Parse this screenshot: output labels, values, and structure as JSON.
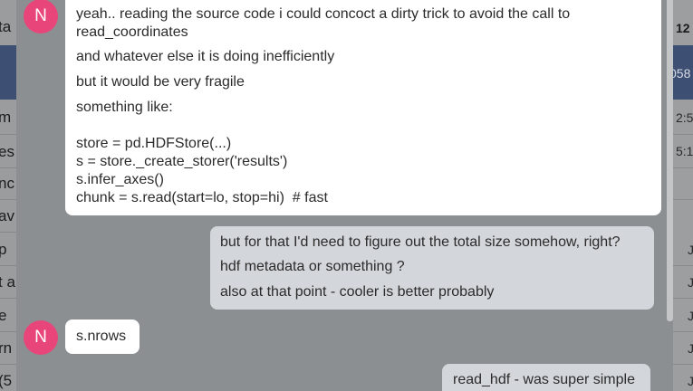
{
  "background_fragments": {
    "left": [
      "ta",
      "m",
      "es",
      "nc",
      "av",
      "p",
      "t a",
      "e",
      "rn",
      "(5"
    ],
    "right": [
      "12",
      "058",
      "2:5",
      "5:1",
      "J",
      "J",
      "J",
      "J",
      "J"
    ]
  },
  "messages": [
    {
      "direction": "incoming",
      "avatar_letter": "N",
      "lines": [
        "yeah.. reading the source code i could concoct a dirty trick to avoid the call to read_coordinates",
        "and whatever else it is doing inefficiently",
        "but it would be very fragile",
        "something like:"
      ],
      "code": [
        "store = pd.HDFStore(...)",
        "s = store._create_storer('results')",
        "s.infer_axes()",
        "chunk = s.read(start=lo, stop=hi)  # fast"
      ]
    },
    {
      "direction": "outgoing",
      "lines": [
        "but for that I'd need to figure out the total size somehow, right?",
        "hdf metadata  or something ?",
        "also at that point - cooler is better probably"
      ]
    },
    {
      "direction": "incoming",
      "avatar_letter": "N",
      "lines": [
        "s.nrows"
      ]
    },
    {
      "direction": "outgoing",
      "lines": [
        "read_hdf - was super simple"
      ]
    }
  ],
  "colors": {
    "avatar": "#e8457a",
    "incoming_bubble": "#ffffff",
    "outgoing_bubble": "#d3d6da",
    "overlay": "#8c8f92"
  }
}
